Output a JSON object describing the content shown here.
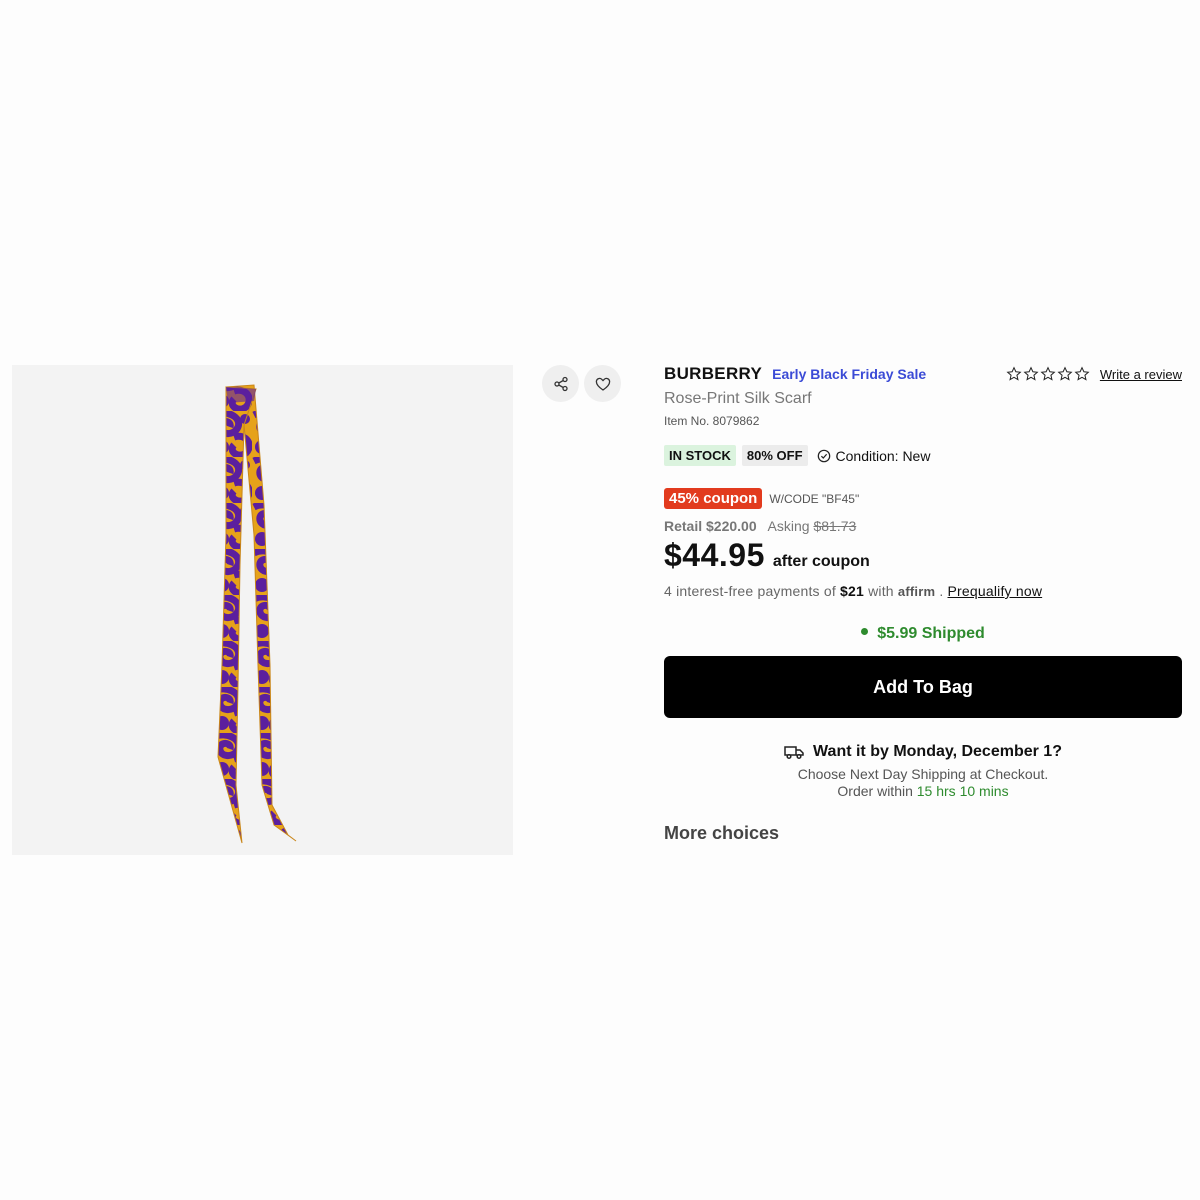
{
  "product": {
    "brand": "BURBERRY",
    "sale_label": "Early Black Friday Sale",
    "name": "Rose-Print Silk Scarf",
    "item_no": "Item No. 8079862",
    "rating_stars": 0,
    "write_review_label": "Write a review"
  },
  "badges": {
    "stock": "IN STOCK",
    "discount": "80% OFF",
    "condition": "Condition: New"
  },
  "coupon": {
    "label": "45% coupon",
    "code": "W/CODE \"BF45\""
  },
  "pricing": {
    "retail_label": "Retail",
    "retail_value": "$220.00",
    "asking_label": "Asking",
    "asking_value": "$81.73",
    "price": "$44.95",
    "after_label": "after coupon",
    "affirm_prefix": "4 interest-free payments of",
    "affirm_amount": "$21",
    "affirm_with": "with",
    "affirm_brand": "affirm",
    "affirm_dot": ".",
    "prequalify_label": "Prequalify now"
  },
  "shipping": {
    "shipped_label": "$5.99 Shipped",
    "add_to_bag_label": "Add To Bag",
    "delivery_heading": "Want it by Monday, December 1?",
    "delivery_sub": "Choose Next Day Shipping at Checkout.",
    "order_within_prefix": "Order within",
    "order_within_time": "15 hrs 10 mins"
  },
  "more_choices_label": "More choices",
  "icons": {
    "share": "share-icon",
    "wishlist": "heart-icon",
    "condition": "check-circle-icon",
    "truck": "truck-icon",
    "star": "star-outline-icon"
  },
  "colors": {
    "sale_blue": "#3b4bd6",
    "coupon_red": "#e23b1e",
    "green": "#2e8b2e",
    "stock_bg": "#dbf3de",
    "scarf_purple": "#5b1f9e",
    "scarf_gold": "#e6a21a"
  }
}
